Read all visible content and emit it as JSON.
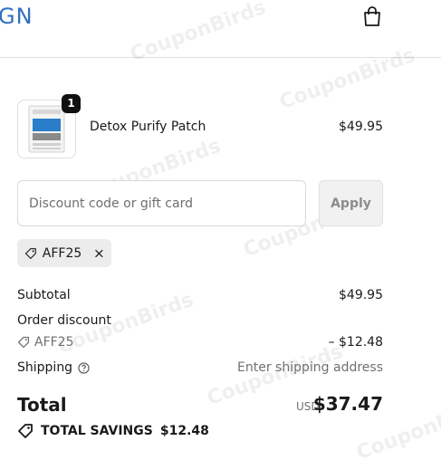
{
  "header": {
    "logo_text": "GN",
    "bag_icon": "shopping-bag-icon"
  },
  "cart": {
    "item": {
      "quantity": "1",
      "name": "Detox Purify Patch",
      "price": "$49.95",
      "thumbnail_text": "DETOX"
    }
  },
  "discount": {
    "placeholder": "Discount code or gift card",
    "apply_label": "Apply",
    "applied_code": "AFF25"
  },
  "summary": {
    "subtotal_label": "Subtotal",
    "subtotal_value": "$49.95",
    "order_discount_label": "Order discount",
    "order_discount_code": "AFF25",
    "order_discount_value": "– $12.48",
    "shipping_label": "Shipping",
    "shipping_value": "Enter shipping address",
    "total_label": "Total",
    "currency": "USD",
    "total_value": "$37.47",
    "savings_label": "TOTAL SAVINGS",
    "savings_value": "$12.48"
  },
  "watermark": "CouponBirds",
  "colors": {
    "logo": "#2f6fc2",
    "text": "#1a1a1a",
    "muted": "#707070",
    "apply_bg": "#f1f1f1"
  }
}
